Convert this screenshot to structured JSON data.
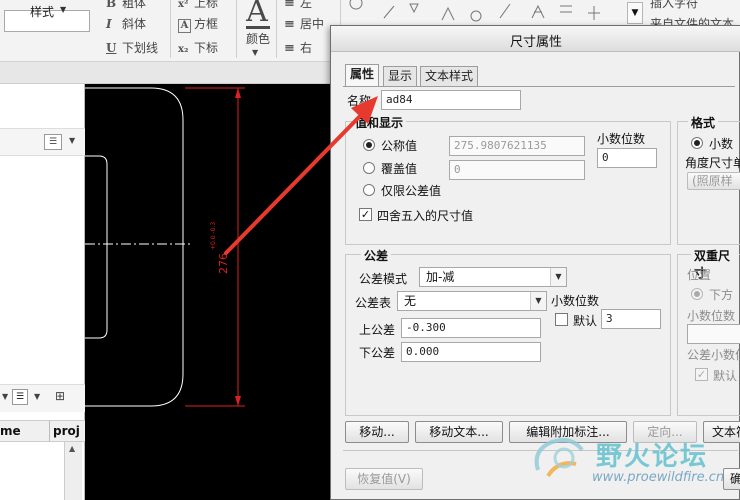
{
  "ribbon": {
    "format_items": [
      {
        "glyph": "B",
        "label": "粗体"
      },
      {
        "glyph": "I",
        "label": "斜体"
      },
      {
        "glyph": "U",
        "label": "下划线"
      }
    ],
    "script_items": [
      {
        "glyph": "x²",
        "label": "上标"
      },
      {
        "glyph": "A",
        "label": "方框"
      },
      {
        "glyph": "x₂",
        "label": "下标"
      }
    ],
    "color_label": "颜色",
    "align_items": [
      "左",
      "居中",
      "右"
    ],
    "insert_symbol": "插入字符",
    "from_file": "来自文件的文本",
    "style_label": "样式"
  },
  "model_tree": {
    "col_name": "me",
    "col_project": "proj"
  },
  "graphics": {
    "dimension_text": "276",
    "tolerance_text": "+0.0 -0.3"
  },
  "dialog": {
    "title": "尺寸属性",
    "tabs": [
      "属性",
      "显示",
      "文本样式"
    ],
    "name_label": "名称",
    "name_value": "ad84",
    "value_group": {
      "title": "值和显示",
      "nominal_label": "公称值",
      "nominal_value": "275.9807621135",
      "override_label": "覆盖值",
      "override_value": "0",
      "tolerance_only_label": "仅限公差值",
      "rounded_label": "四舍五入的尺寸值",
      "decimals_label": "小数位数",
      "decimals_value": "0"
    },
    "format_group": {
      "title": "格式",
      "decimal_label": "小数",
      "angle_label": "角度尺寸单",
      "as_is_button": "(照原样"
    },
    "tolerance_group": {
      "title": "公差",
      "mode_label": "公差模式",
      "mode_value": "加-减",
      "table_label": "公差表",
      "table_value": "无",
      "decimals_label": "小数位数",
      "default_label": "默认",
      "default_value": "3",
      "upper_label": "上公差",
      "upper_value": "-0.300",
      "lower_label": "下公差",
      "lower_value": "0.000"
    },
    "dual_group": {
      "title": "双重尺寸",
      "position_label": "位置",
      "below_label": "下方",
      "decimals_label": "小数位数",
      "tol_decimals_label": "公差小数位",
      "default_label": "默认"
    },
    "buttons": {
      "move": "移动...",
      "move_text": "移动文本...",
      "edit_attach": "编辑附加标注...",
      "orient": "定向...",
      "text_sym": "文本符",
      "restore": "恢复值(V)",
      "ok": "确"
    }
  },
  "watermark": {
    "text": "野火论坛",
    "url": "www.proewildfire.cn"
  },
  "colors": {
    "dimension_red": "#e02020",
    "arrow_red": "#e8392f",
    "geometry_white": "#ffffff",
    "background_black": "#000000"
  }
}
